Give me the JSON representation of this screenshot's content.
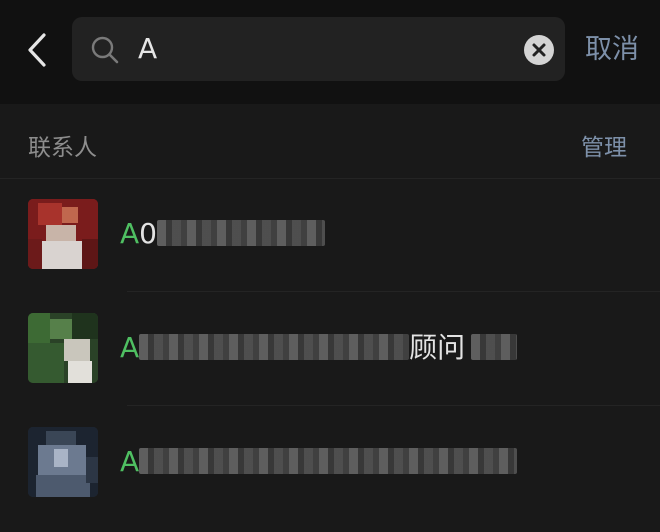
{
  "header": {
    "search_query": "A",
    "cancel_label": "取消"
  },
  "section": {
    "title": "联系人",
    "manage_label": "管理"
  },
  "contacts": [
    {
      "highlight": "A",
      "name_visible": "0",
      "name_suffix": "",
      "avatar_color": "#8c1f1f"
    },
    {
      "highlight": "A",
      "name_visible": "",
      "name_suffix": "顾问",
      "avatar_color": "#2d4a2a"
    },
    {
      "highlight": "A",
      "name_visible": "",
      "name_suffix": "",
      "avatar_color": "#2b3340"
    }
  ],
  "colors": {
    "background": "#191919",
    "header_bg": "#111111",
    "accent_link": "#7d90a9",
    "highlight_match": "#4fbf62"
  },
  "icons": {
    "back": "chevron-left-icon",
    "search": "search-icon",
    "clear": "clear-circle-icon"
  }
}
